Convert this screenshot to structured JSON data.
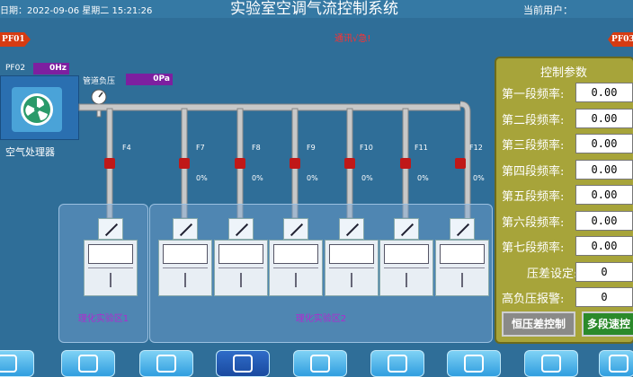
{
  "header": {
    "datetime": "日期：2022-09-06 星期二 15:21:26",
    "title": "实验室空调气流控制系统",
    "user_label": "当前用户："
  },
  "status_text": "通讯√急!",
  "nav_left": "PF01",
  "nav_right": "PF03",
  "ahu": {
    "name": "空气处理器",
    "freq_label": "PF02",
    "freq_value": "0Hz",
    "duct_label": "管道负压",
    "duct_value": "0Pa"
  },
  "valves": [
    {
      "name": "F4",
      "pct": ""
    },
    {
      "name": "F7",
      "pct": "0%"
    },
    {
      "name": "F8",
      "pct": "0%"
    },
    {
      "name": "F9",
      "pct": "0%"
    },
    {
      "name": "F10",
      "pct": "0%"
    },
    {
      "name": "F11",
      "pct": "0%"
    },
    {
      "name": "F12",
      "pct": "0%"
    }
  ],
  "zones": {
    "left_label": "理化实验区1",
    "right_label": "理化实验区2"
  },
  "panel": {
    "title": "控制参数",
    "rows": [
      {
        "label": "第一段频率:",
        "value": "0.00"
      },
      {
        "label": "第二段频率:",
        "value": "0.00"
      },
      {
        "label": "第三段频率:",
        "value": "0.00"
      },
      {
        "label": "第四段频率:",
        "value": "0.00"
      },
      {
        "label": "第五段频率:",
        "value": "0.00"
      },
      {
        "label": "第六段频率:",
        "value": "0.00"
      },
      {
        "label": "第七段频率:",
        "value": "0.00"
      },
      {
        "label": "压差设定:",
        "value": "0"
      },
      {
        "label": "高负压报警:",
        "value": "0"
      }
    ],
    "btn_constant": "恒压差控制",
    "btn_multi": "多段速控"
  },
  "nav_icons": [
    "home-icon",
    "monitor-icon",
    "chart-icon",
    "hand-icon",
    "report-icon",
    "history-icon",
    "settings-icon",
    "user-icon",
    "power-icon"
  ]
}
